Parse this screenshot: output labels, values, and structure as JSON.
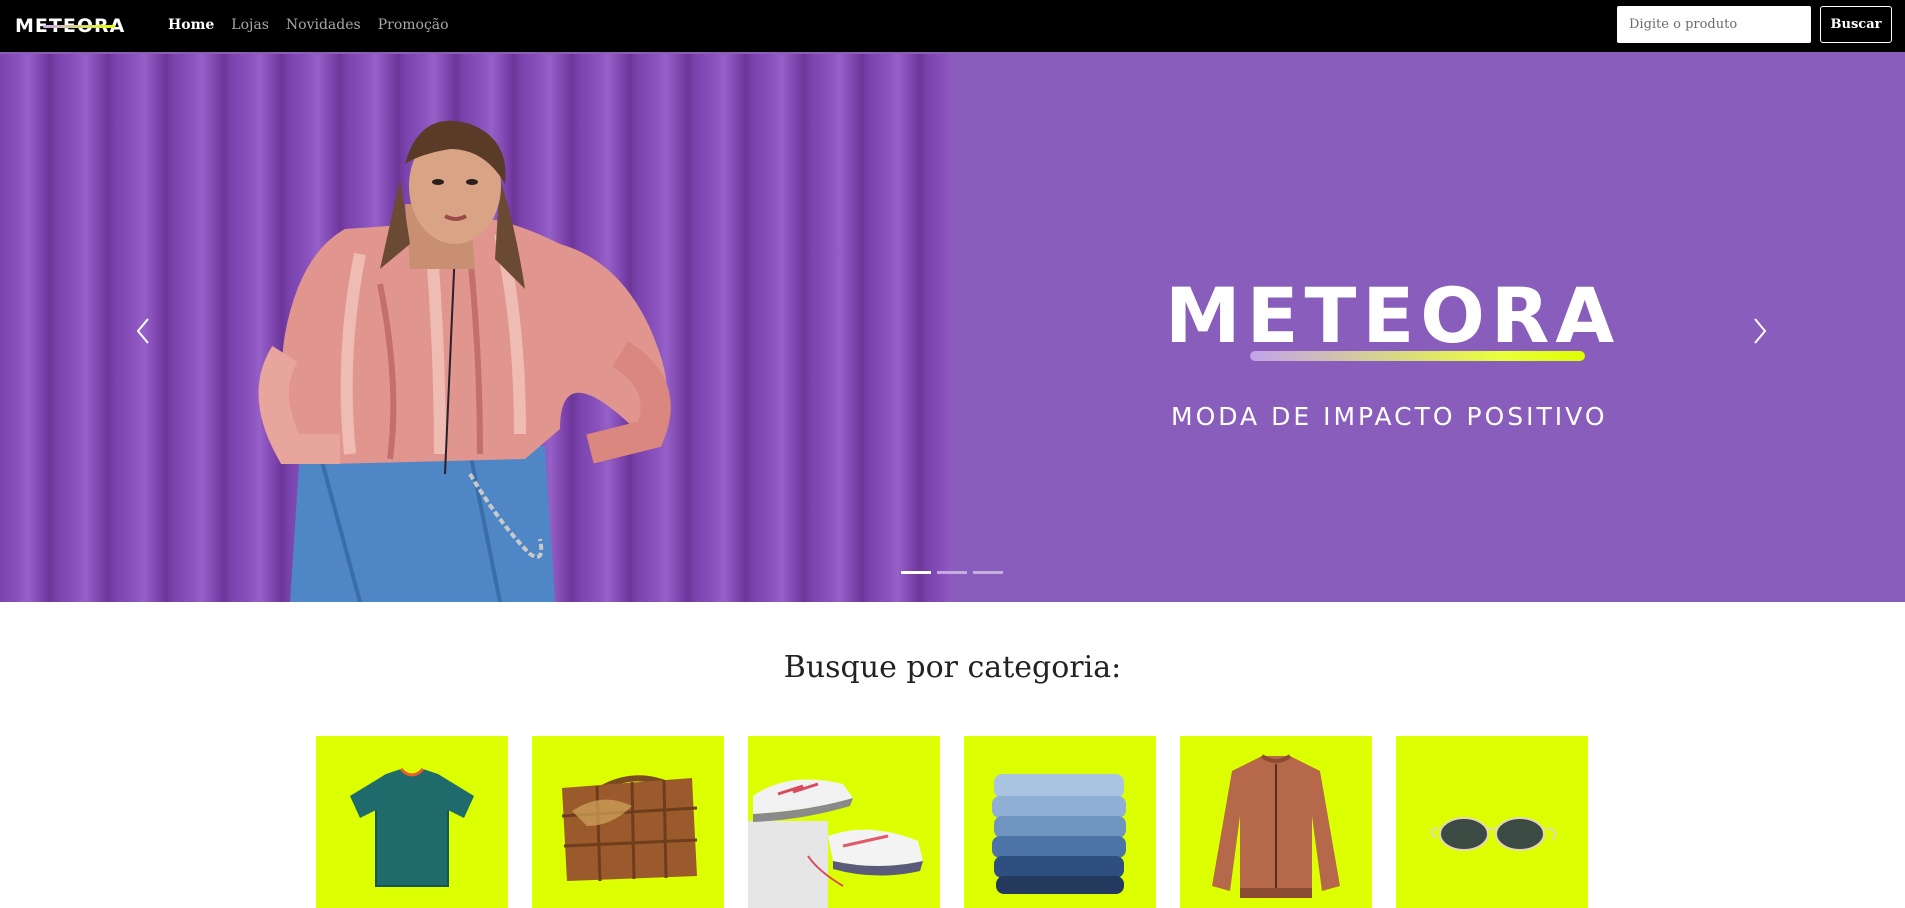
{
  "navbar": {
    "brand": "METEORA",
    "links": [
      "Home",
      "Lojas",
      "Novidades",
      "Promoção"
    ],
    "search_placeholder": "Digite o produto",
    "search_button": "Buscar"
  },
  "hero": {
    "logo": "METEORA",
    "tagline": "MODA DE IMPACTO POSITIVO",
    "slide_count": 3,
    "active_slide": 1
  },
  "categories": {
    "title": "Busque por categoria:",
    "items": [
      "camiseta",
      "bolsa",
      "tênis",
      "calças jeans",
      "jaqueta",
      "óculos"
    ]
  },
  "colors": {
    "navbar_bg": "#000000",
    "hero_purple": "#885dbb",
    "category_bg": "#dcff01",
    "accent_lime": "#e8ff00"
  }
}
